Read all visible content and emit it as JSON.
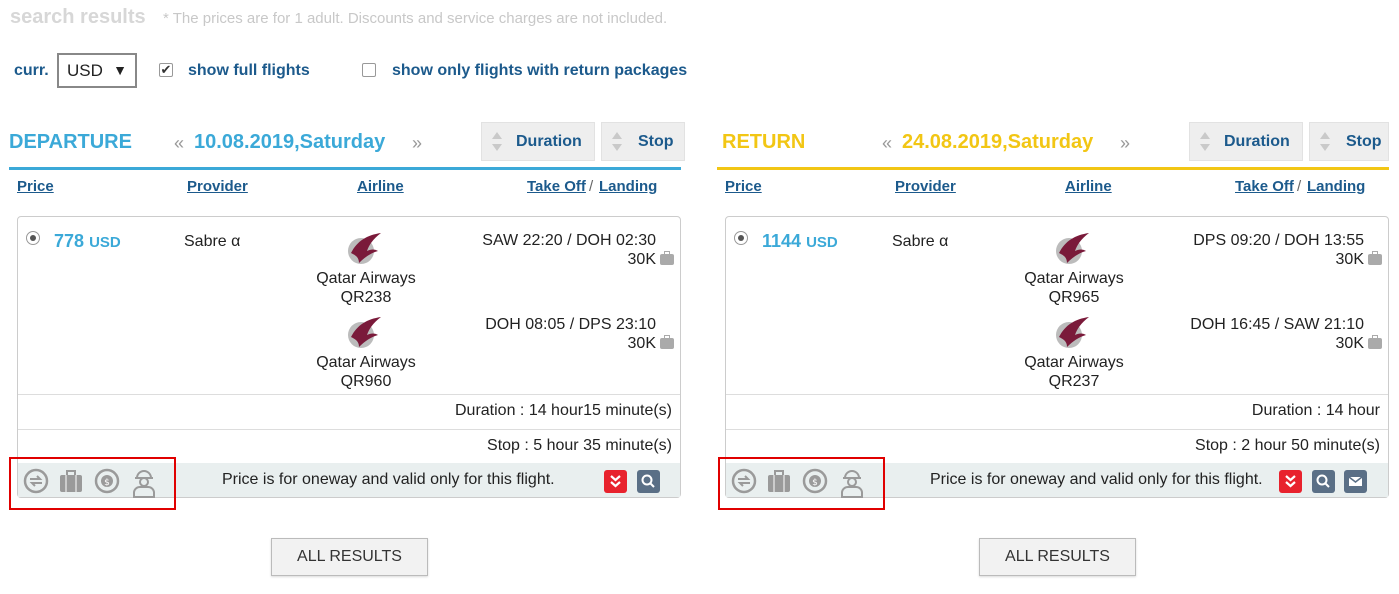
{
  "header": {
    "title": "search results",
    "note": "* The prices are for 1 adult. Discounts and service charges are not included."
  },
  "options": {
    "currency_label": "curr.",
    "currency_value": "USD",
    "show_full_flights_label": "show full flights",
    "show_full_flights_checked": true,
    "return_packages_label": "show only flights with return packages",
    "return_packages_checked": false
  },
  "colors": {
    "departure": "#3ba9d8",
    "return": "#f2c614",
    "link": "#1c5a8c",
    "highlight": "#e00000"
  },
  "columns": {
    "price": "Price",
    "provider": "Provider",
    "airline": "Airline",
    "takeoff": "Take Off",
    "sep": "/",
    "landing": "Landing"
  },
  "sort": {
    "duration": "Duration",
    "stop": "Stop"
  },
  "departure": {
    "title": "DEPARTURE",
    "prev": "«",
    "date": "10.08.2019,Saturday",
    "next": "»",
    "price": "778",
    "currency": "USD",
    "provider": "Sabre α",
    "segments": [
      {
        "airline": "Qatar Airways",
        "flight": "QR238",
        "times": "SAW 22:20 / DOH  02:30",
        "baggage": "30K"
      },
      {
        "airline": "Qatar Airways",
        "flight": "QR960",
        "times": "DOH 08:05 / DPS  23:10",
        "baggage": "30K"
      }
    ],
    "duration": "Duration : 14 hour15 minute(s)",
    "stop": "Stop : 5 hour  35 minute(s)",
    "footer_note": "Price is for oneway and valid only for this flight.",
    "icons": [
      "refund-icon",
      "baggage-icon",
      "money-icon",
      "worker-icon"
    ],
    "all_results": "ALL RESULTS"
  },
  "return": {
    "title": "RETURN",
    "prev": "«",
    "date": "24.08.2019,Saturday",
    "next": "»",
    "price": "1144",
    "currency": "USD",
    "provider": "Sabre α",
    "segments": [
      {
        "airline": "Qatar Airways",
        "flight": "QR965",
        "times": "DPS 09:20 / DOH  13:55",
        "baggage": "30K"
      },
      {
        "airline": "Qatar Airways",
        "flight": "QR237",
        "times": "DOH 16:45 / SAW  21:10",
        "baggage": "30K"
      }
    ],
    "duration": "Duration : 14 hour",
    "stop": "Stop : 2 hour  50 minute(s)",
    "footer_note": "Price is for oneway and valid only for this flight.",
    "icons": [
      "refund-icon",
      "baggage-icon",
      "money-icon",
      "worker-icon"
    ],
    "all_results": "ALL RESULTS"
  }
}
